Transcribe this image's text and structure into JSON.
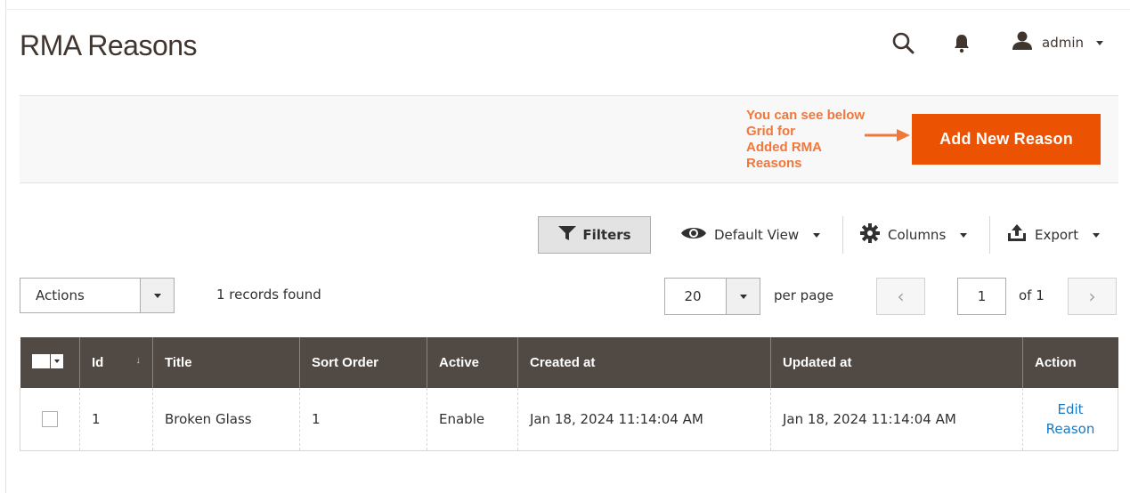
{
  "header": {
    "page_title": "RMA Reasons",
    "user_name": "admin"
  },
  "action_bar": {
    "note_lines": [
      "You can see below",
      "Grid for",
      "Added RMA",
      "Reasons"
    ],
    "add_button_label": "Add New Reason"
  },
  "toolbar": {
    "filters_label": "Filters",
    "view_label": "Default View",
    "columns_label": "Columns",
    "export_label": "Export"
  },
  "grid_controls": {
    "actions_label": "Actions",
    "records_found": "1 records found",
    "per_page_value": "20",
    "per_page_label": "per page",
    "page_value": "1",
    "of_pages": "of 1",
    "prev_symbol": "‹",
    "next_symbol": "›"
  },
  "table": {
    "columns": [
      "Id",
      "Title",
      "Sort Order",
      "Active",
      "Created at",
      "Updated at",
      "Action"
    ],
    "sort_indicator": "↓",
    "rows": [
      {
        "id": "1",
        "title": "Broken Glass",
        "sort_order": "1",
        "active": "Enable",
        "created_at": "Jan 18, 2024 11:14:04 AM",
        "updated_at": "Jan 18, 2024 11:14:04 AM",
        "action_line1": "Edit",
        "action_line2": "Reason"
      }
    ]
  },
  "colors": {
    "accent": "#eb5202",
    "note": "#f2773b",
    "header_bg": "#514943",
    "link": "#1979c3"
  }
}
